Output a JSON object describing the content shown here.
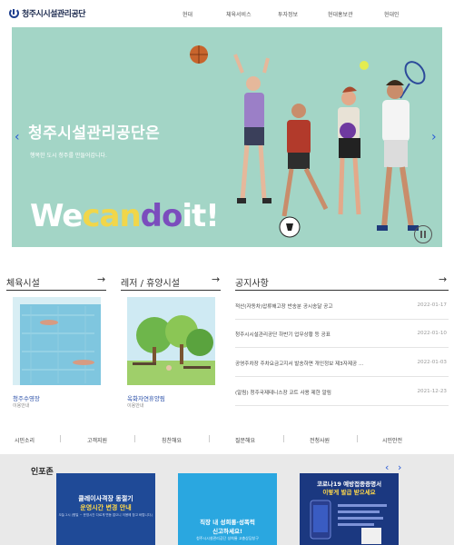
{
  "header": {
    "logo_text": "청주시시설관리공단",
    "nav": [
      "현대",
      "체육서비스",
      "투자정보",
      "현대홍보관",
      "현대인"
    ]
  },
  "hero": {
    "title": "청주시설관리공단은",
    "subtitle": "행복한 도시 청주를 만들어갑니다.",
    "slogan": [
      "We",
      "can",
      "do",
      "it",
      "!"
    ],
    "prev_icon": "‹",
    "next_icon": "›",
    "bg_color": "#a3d5c6"
  },
  "sections": {
    "sports": {
      "title": "체육시설",
      "arrow": "→",
      "card_name": "청주수영장",
      "card_sub": "이용안내"
    },
    "leisure": {
      "title": "레저 / 휴양시설",
      "arrow": "→",
      "card_name": "옥화자연휴양림",
      "card_sub": "이용안내"
    },
    "notice": {
      "title": "공지사항",
      "arrow": "→",
      "items": [
        {
          "text": "적산(자동차)압류해고장 반송분 공시송달 공고",
          "date": "2022-01-17"
        },
        {
          "text": "청주시시설관리공단 하반기 업무상황 등 공표",
          "date": "2022-01-10"
        },
        {
          "text": "공영주차장 주차요금고지서 발송하면 개인정보 제3자제공 ...",
          "date": "2022-01-03"
        },
        {
          "text": "(알림) 청주국제테니스장 코트 사용 제한 알림",
          "date": "2021-12-23"
        }
      ]
    }
  },
  "quick_links": [
    "시민소리",
    "고객지원",
    "칭찬해요",
    "질문해요",
    "전청사원",
    "시민안전"
  ],
  "infozone": {
    "title": "인포존",
    "prev_icon": "‹",
    "next_icon": "›",
    "banner1": {
      "line1": "클레이사격장 동절기",
      "line2": "운영시간 변경 안내",
      "line3": "오늘 2시 (평일 ~ 운영시간 다르게 변동 없으니 이용에 참고 바랍니다.)"
    },
    "banner2": {
      "line1": "직장 내 성희롱·성폭력",
      "line2": "신고하세요!",
      "line3": "청주시시설관리공단 성희롱 고충상담창구"
    },
    "banner3": {
      "line1": "코로나19 예방접종증명서",
      "line2": "이렇게 발급 받으세요"
    }
  }
}
